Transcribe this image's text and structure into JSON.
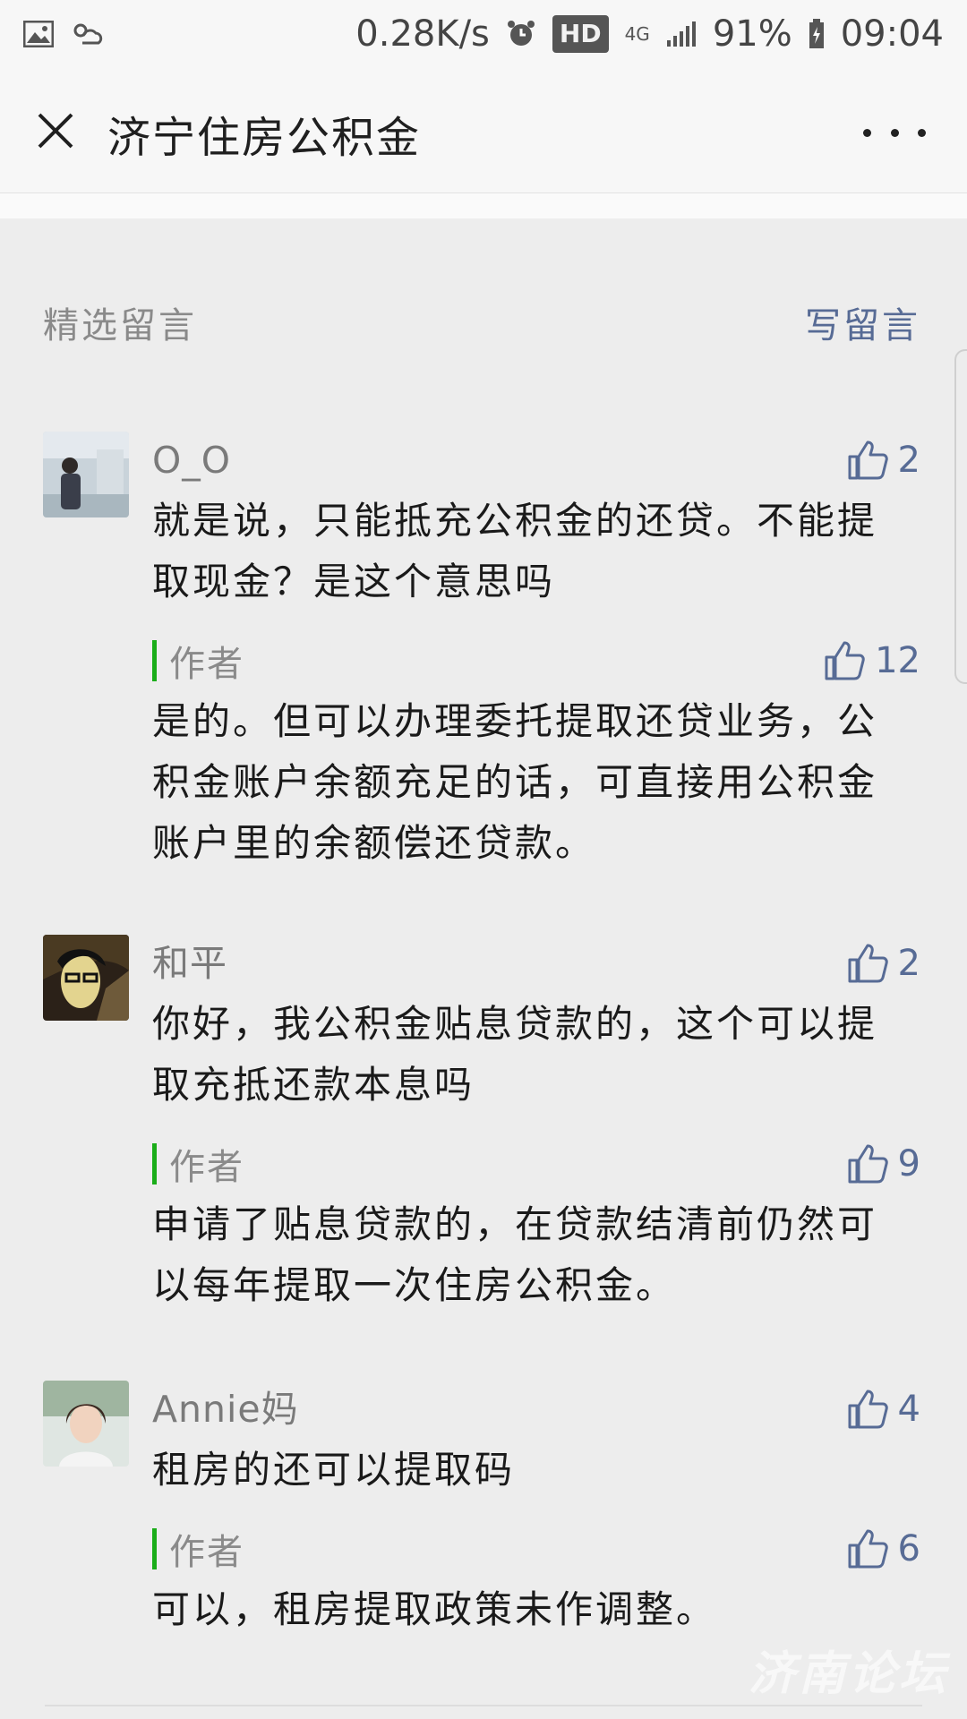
{
  "status_bar": {
    "net_speed": "0.28K/s",
    "hd": "HD",
    "net_type": "4G",
    "battery": "91%",
    "time": "09:04"
  },
  "header": {
    "title": "济宁住房公积金"
  },
  "section": {
    "title": "精选留言",
    "write_label": "写留言"
  },
  "comments": [
    {
      "nickname": "O_O",
      "likes": "2",
      "text_lines": [
        "就是说，只能抵充公积金的还贷。不能提",
        "取现金？是这个意思吗"
      ],
      "reply": {
        "label": "作者",
        "likes": "12",
        "text_lines": [
          "是的。但可以办理委托提取还贷业务，公",
          "积金账户余额充足的话，可直接用公积金",
          "账户里的余额偿还贷款。"
        ]
      }
    },
    {
      "nickname": "和平",
      "likes": "2",
      "text_lines": [
        "你好，我公积金贴息贷款的，这个可以提",
        "取充抵还款本息吗"
      ],
      "reply": {
        "label": "作者",
        "likes": "9",
        "text_lines": [
          "申请了贴息贷款的，在贷款结清前仍然可",
          "以每年提取一次住房公积金。"
        ]
      }
    },
    {
      "nickname": "Annie妈",
      "likes": "4",
      "text_lines": [
        "租房的还可以提取码"
      ],
      "reply": {
        "label": "作者",
        "likes": "6",
        "text_lines": [
          "可以，租房提取政策未作调整。"
        ]
      }
    }
  ],
  "watermark": "济南论坛",
  "colors": {
    "link": "#576b95",
    "author_bar": "#1aad19",
    "background": "#ededed"
  }
}
